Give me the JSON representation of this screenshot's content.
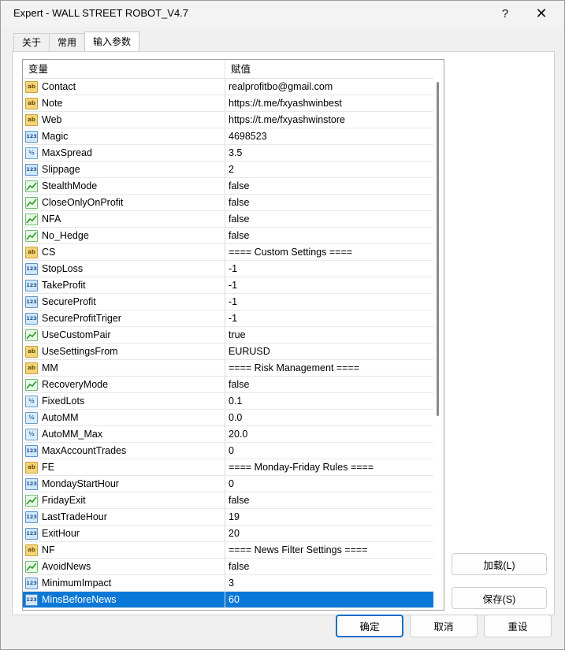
{
  "window": {
    "title": "Expert - WALL STREET ROBOT_V4.7",
    "help_glyph": "?",
    "close_glyph": "✕"
  },
  "tabs": [
    {
      "label": "关于"
    },
    {
      "label": "常用"
    },
    {
      "label": "输入参数"
    }
  ],
  "grid": {
    "headers": [
      "变量",
      "赋值"
    ],
    "rows": [
      {
        "type": "string",
        "name": "Contact",
        "value": "realprofitbo@gmail.com"
      },
      {
        "type": "string",
        "name": "Note",
        "value": "https://t.me/fxyashwinbest"
      },
      {
        "type": "string",
        "name": "Web",
        "value": "https://t.me/fxyashwinstore"
      },
      {
        "type": "int",
        "name": "Magic",
        "value": "4698523"
      },
      {
        "type": "double",
        "name": "MaxSpread",
        "value": "3.5"
      },
      {
        "type": "int",
        "name": "Slippage",
        "value": "2"
      },
      {
        "type": "bool",
        "name": "StealthMode",
        "value": "false"
      },
      {
        "type": "bool",
        "name": "CloseOnlyOnProfit",
        "value": "false"
      },
      {
        "type": "bool",
        "name": "NFA",
        "value": "false"
      },
      {
        "type": "bool",
        "name": "No_Hedge",
        "value": "false"
      },
      {
        "type": "string",
        "name": "CS",
        "value": "==== Custom Settings ===="
      },
      {
        "type": "int",
        "name": "StopLoss",
        "value": "-1"
      },
      {
        "type": "int",
        "name": "TakeProfit",
        "value": "-1"
      },
      {
        "type": "int",
        "name": "SecureProfit",
        "value": "-1"
      },
      {
        "type": "int",
        "name": "SecureProfitTriger",
        "value": "-1"
      },
      {
        "type": "bool",
        "name": "UseCustomPair",
        "value": "true"
      },
      {
        "type": "string",
        "name": "UseSettingsFrom",
        "value": "EURUSD"
      },
      {
        "type": "string",
        "name": "MM",
        "value": "==== Risk Management ===="
      },
      {
        "type": "bool",
        "name": "RecoveryMode",
        "value": "false"
      },
      {
        "type": "double",
        "name": "FixedLots",
        "value": "0.1"
      },
      {
        "type": "double",
        "name": "AutoMM",
        "value": "0.0"
      },
      {
        "type": "double",
        "name": "AutoMM_Max",
        "value": "20.0"
      },
      {
        "type": "int",
        "name": "MaxAccountTrades",
        "value": "0"
      },
      {
        "type": "string",
        "name": "FE",
        "value": "==== Monday-Friday Rules ===="
      },
      {
        "type": "int",
        "name": "MondayStartHour",
        "value": "0"
      },
      {
        "type": "bool",
        "name": "FridayExit",
        "value": "false"
      },
      {
        "type": "int",
        "name": "LastTradeHour",
        "value": "19"
      },
      {
        "type": "int",
        "name": "ExitHour",
        "value": "20"
      },
      {
        "type": "string",
        "name": "NF",
        "value": "==== News Filter Settings ===="
      },
      {
        "type": "bool",
        "name": "AvoidNews",
        "value": "false"
      },
      {
        "type": "int",
        "name": "MinimumImpact",
        "value": "3"
      },
      {
        "type": "int",
        "name": "MinsBeforeNews",
        "value": "60",
        "selected": true
      }
    ]
  },
  "icon_glyphs": {
    "string": "ab",
    "int": "123",
    "double": "½"
  },
  "buttons": {
    "load": "加载(L)",
    "save": "保存(S)",
    "ok": "确定",
    "cancel": "取消",
    "reset": "重设"
  },
  "colors": {
    "selection": "#0a78d7",
    "ok_border": "#1a6fc4"
  }
}
